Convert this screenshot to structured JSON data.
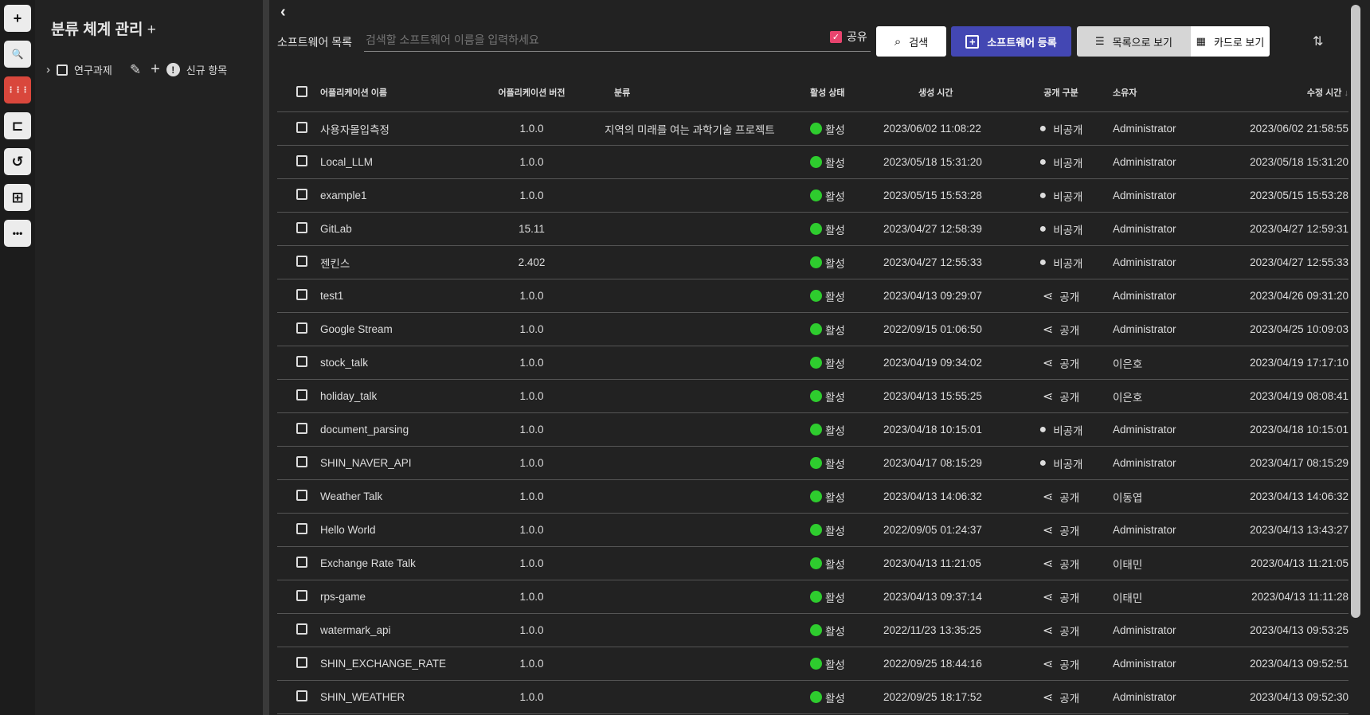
{
  "rail": {
    "items": [
      {
        "icon": "plus-icon",
        "glyph": "+"
      },
      {
        "icon": "clipboard-search-icon",
        "glyph": "🔍"
      },
      {
        "icon": "apps-grid-icon",
        "glyph": "⋮⋮⋮",
        "active": true
      },
      {
        "icon": "hierarchy-icon",
        "glyph": "⊏"
      },
      {
        "icon": "history-icon",
        "glyph": "↺"
      },
      {
        "icon": "dashboard-icon",
        "glyph": "⊞"
      },
      {
        "icon": "more-icon",
        "glyph": "•••"
      }
    ]
  },
  "sidebar": {
    "title": "분류 체계 관리",
    "add": "+",
    "tree": {
      "label": "연구과제",
      "new_item": "신규 항목"
    }
  },
  "toolbar": {
    "back": "‹",
    "list_label": "소프트웨어 목록",
    "search_placeholder": "검색할 소프트웨어 이름을 입력하세요",
    "search_value": "",
    "share_label": "공유",
    "share_checked": true,
    "search_button": "검색",
    "register_button": "소프트웨어 등록",
    "list_view": "목록으로 보기",
    "card_view": "카드로 보기",
    "accent": "#4347b3"
  },
  "table": {
    "headers": [
      "어플리케이션 이름",
      "어플리케이션 버전",
      "분류",
      "활성 상태",
      "생성 시간",
      "공개 구분",
      "소유자",
      "수정 시간"
    ],
    "sort": {
      "column": "수정 시간",
      "direction": "desc"
    },
    "rows": [
      {
        "name": "사용자몰입측정",
        "version": "1.0.0",
        "category": "지역의 미래를 여는 과학기술 프로젝트",
        "status": "활성",
        "created": "2023/06/02 11:08:22",
        "visibility": "비공개",
        "owner": "Administrator",
        "modified": "2023/06/02 21:58:55"
      },
      {
        "name": "Local_LLM",
        "version": "1.0.0",
        "category": "",
        "status": "활성",
        "created": "2023/05/18 15:31:20",
        "visibility": "비공개",
        "owner": "Administrator",
        "modified": "2023/05/18 15:31:20"
      },
      {
        "name": "example1",
        "version": "1.0.0",
        "category": "",
        "status": "활성",
        "created": "2023/05/15 15:53:28",
        "visibility": "비공개",
        "owner": "Administrator",
        "modified": "2023/05/15 15:53:28"
      },
      {
        "name": "GitLab",
        "version": "15.11",
        "category": "",
        "status": "활성",
        "created": "2023/04/27 12:58:39",
        "visibility": "비공개",
        "owner": "Administrator",
        "modified": "2023/04/27 12:59:31"
      },
      {
        "name": "젠킨스",
        "version": "2.402",
        "category": "",
        "status": "활성",
        "created": "2023/04/27 12:55:33",
        "visibility": "비공개",
        "owner": "Administrator",
        "modified": "2023/04/27 12:55:33"
      },
      {
        "name": "test1",
        "version": "1.0.0",
        "category": "",
        "status": "활성",
        "created": "2023/04/13 09:29:07",
        "visibility": "공개",
        "owner": "Administrator",
        "modified": "2023/04/26 09:31:20"
      },
      {
        "name": "Google Stream",
        "version": "1.0.0",
        "category": "",
        "status": "활성",
        "created": "2022/09/15 01:06:50",
        "visibility": "공개",
        "owner": "Administrator",
        "modified": "2023/04/25 10:09:03"
      },
      {
        "name": "stock_talk",
        "version": "1.0.0",
        "category": "",
        "status": "활성",
        "created": "2023/04/19 09:34:02",
        "visibility": "공개",
        "owner": "이은호",
        "modified": "2023/04/19 17:17:10"
      },
      {
        "name": "holiday_talk",
        "version": "1.0.0",
        "category": "",
        "status": "활성",
        "created": "2023/04/13 15:55:25",
        "visibility": "공개",
        "owner": "이은호",
        "modified": "2023/04/19 08:08:41"
      },
      {
        "name": "document_parsing",
        "version": "1.0.0",
        "category": "",
        "status": "활성",
        "created": "2023/04/18 10:15:01",
        "visibility": "비공개",
        "owner": "Administrator",
        "modified": "2023/04/18 10:15:01"
      },
      {
        "name": "SHIN_NAVER_API",
        "version": "1.0.0",
        "category": "",
        "status": "활성",
        "created": "2023/04/17 08:15:29",
        "visibility": "비공개",
        "owner": "Administrator",
        "modified": "2023/04/17 08:15:29"
      },
      {
        "name": "Weather Talk",
        "version": "1.0.0",
        "category": "",
        "status": "활성",
        "created": "2023/04/13 14:06:32",
        "visibility": "공개",
        "owner": "이동엽",
        "modified": "2023/04/13 14:06:32"
      },
      {
        "name": "Hello World",
        "version": "1.0.0",
        "category": "",
        "status": "활성",
        "created": "2022/09/05 01:24:37",
        "visibility": "공개",
        "owner": "Administrator",
        "modified": "2023/04/13 13:43:27"
      },
      {
        "name": "Exchange Rate Talk",
        "version": "1.0.0",
        "category": "",
        "status": "활성",
        "created": "2023/04/13 11:21:05",
        "visibility": "공개",
        "owner": "이태민",
        "modified": "2023/04/13 11:21:05"
      },
      {
        "name": "rps-game",
        "version": "1.0.0",
        "category": "",
        "status": "활성",
        "created": "2023/04/13 09:37:14",
        "visibility": "공개",
        "owner": "이태민",
        "modified": "2023/04/13 11:11:28"
      },
      {
        "name": "watermark_api",
        "version": "1.0.0",
        "category": "",
        "status": "활성",
        "created": "2022/11/23 13:35:25",
        "visibility": "공개",
        "owner": "Administrator",
        "modified": "2023/04/13 09:53:25"
      },
      {
        "name": "SHIN_EXCHANGE_RATE",
        "version": "1.0.0",
        "category": "",
        "status": "활성",
        "created": "2022/09/25 18:44:16",
        "visibility": "공개",
        "owner": "Administrator",
        "modified": "2023/04/13 09:52:51"
      },
      {
        "name": "SHIN_WEATHER",
        "version": "1.0.0",
        "category": "",
        "status": "활성",
        "created": "2022/09/25 18:17:52",
        "visibility": "공개",
        "owner": "Administrator",
        "modified": "2023/04/13 09:52:30"
      }
    ]
  },
  "colors": {
    "active": "#2ecc2e",
    "accent": "#4347b3",
    "rail_active": "#d9473c",
    "share_check": "#e8446e"
  }
}
